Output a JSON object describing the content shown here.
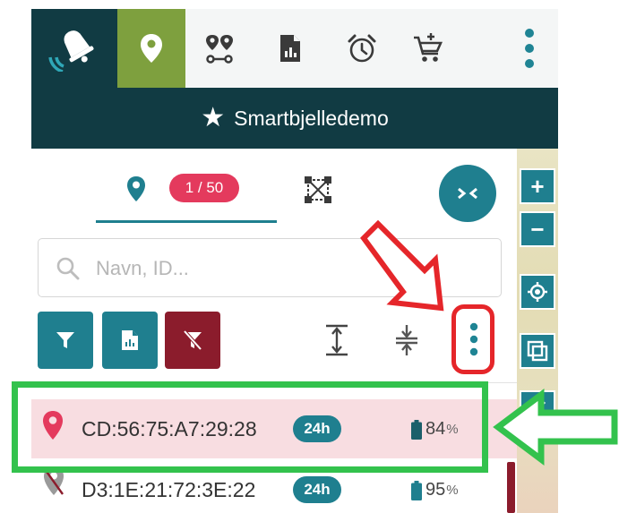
{
  "toolbar": {
    "icons": [
      "bell-logo-icon",
      "map-pin-icon",
      "route-icon",
      "report-icon",
      "alarm-clock-icon",
      "cart-add-icon",
      "more-vertical-icon"
    ],
    "accent": "#7ea03e",
    "dark": "#113b43"
  },
  "title": {
    "text": "Smartbjelledemo",
    "icon": "star-icon"
  },
  "tabs": {
    "count_badge": "1 / 50",
    "items": [
      "map-pin-icon",
      "geofence-icon"
    ],
    "collapse_icon": "collapse-arrows-icon"
  },
  "search": {
    "placeholder": "Navn, ID..."
  },
  "actions": {
    "buttons": [
      "filter-icon",
      "report-icon",
      "clear-filter-icon"
    ],
    "tools": [
      "expand-rows-icon",
      "collapse-rows-icon",
      "more-vertical-icon"
    ]
  },
  "devices": [
    {
      "id": "CD:56:75:A7:29:28",
      "badge": "24h",
      "battery": "84",
      "unit": "%",
      "selected": true
    },
    {
      "id": "D3:1E:21:72:3E:22",
      "badge": "24h",
      "battery": "95",
      "unit": "%",
      "selected": false
    }
  ],
  "map_controls": [
    "+",
    "−"
  ],
  "colors": {
    "teal": "#1f7f8f",
    "pink": "#e43a5d",
    "maroon": "#8b1c2c",
    "highlight": "#f8dde1",
    "annotation_red": "#e5262a",
    "annotation_green": "#33c24d"
  }
}
